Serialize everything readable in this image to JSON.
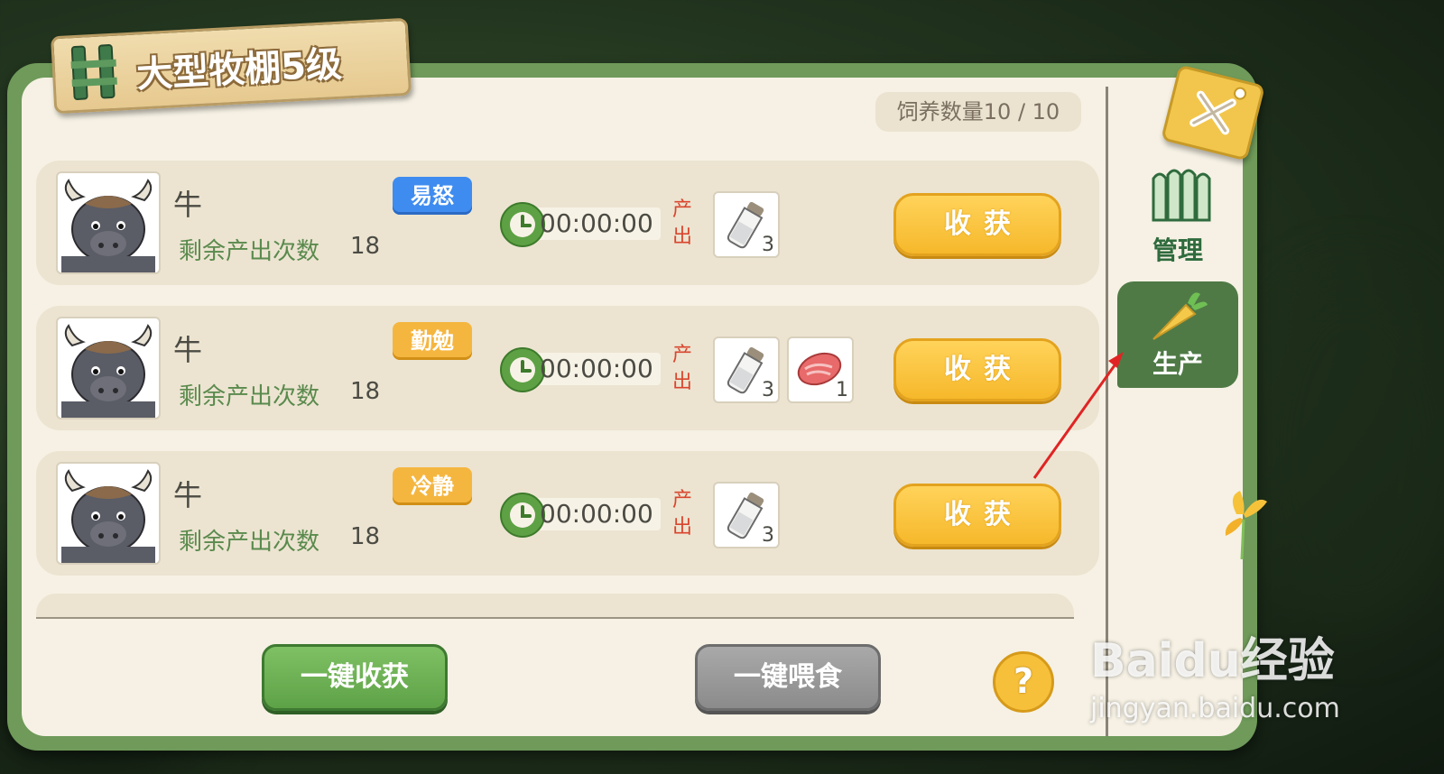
{
  "header": {
    "title": "大型牧棚5级",
    "capacity": "饲养数量10 / 10"
  },
  "side_tabs": [
    {
      "label": "管理",
      "icon": "fence-icon",
      "active": false
    },
    {
      "label": "生产",
      "icon": "carrot-icon",
      "active": true
    }
  ],
  "labels": {
    "remain": "剩余产出次数",
    "output": "产出",
    "harvest": "收获"
  },
  "animals": [
    {
      "name": "牛",
      "trait": "易怒",
      "trait_color": "#3f8cf0",
      "remaining": "18",
      "timer": "00:00:00",
      "outputs": [
        {
          "icon": "milk-bottle-icon",
          "count": "3"
        }
      ]
    },
    {
      "name": "牛",
      "trait": "勤勉",
      "trait_color": "#f5b640",
      "remaining": "18",
      "timer": "00:00:00",
      "outputs": [
        {
          "icon": "milk-bottle-icon",
          "count": "3"
        },
        {
          "icon": "meat-icon",
          "count": "1"
        }
      ]
    },
    {
      "name": "牛",
      "trait": "冷静",
      "trait_color": "#f5b640",
      "remaining": "18",
      "timer": "00:00:00",
      "outputs": [
        {
          "icon": "milk-bottle-icon",
          "count": "3"
        }
      ]
    }
  ],
  "footer": {
    "harvest_all": "一键收获",
    "feed_all": "一键喂食",
    "help": "?"
  },
  "watermark": {
    "brand": "Baidu经验",
    "url": "jingyan.baidu.com"
  },
  "colors": {
    "frame_green": "#6f9a5a",
    "harvest_yellow": "#f6b82b",
    "accent_red_arrow": "#e02424"
  }
}
